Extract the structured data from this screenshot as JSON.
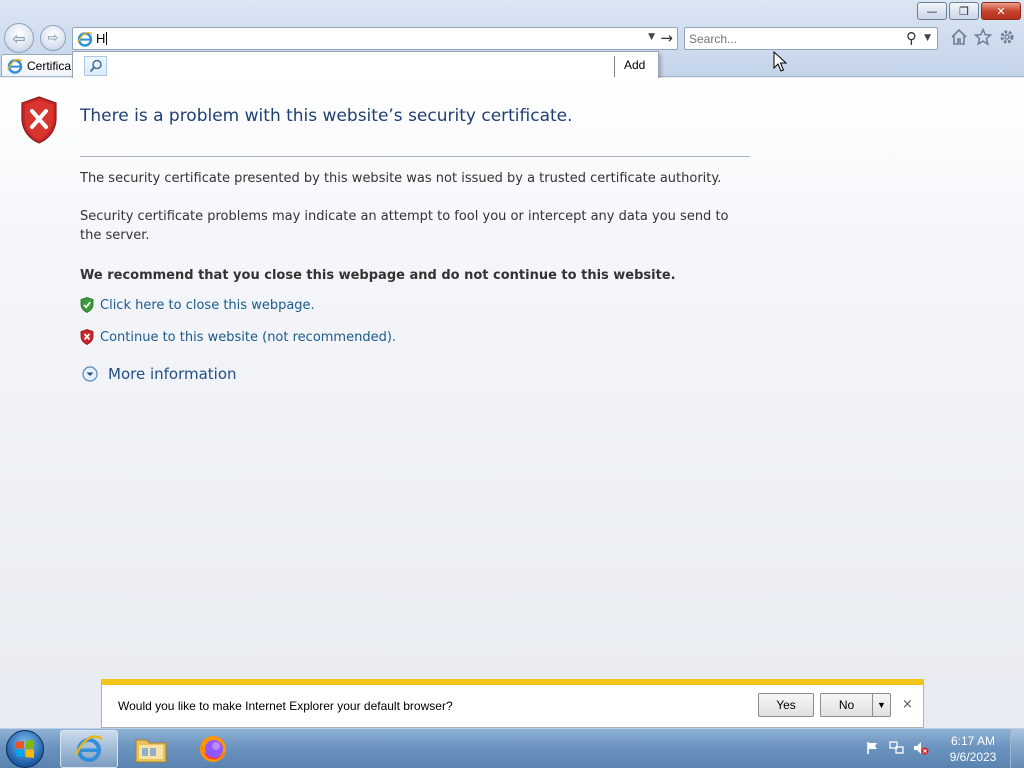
{
  "window": {
    "minimize_glyph": "—",
    "maximize_glyph": "❐",
    "close_glyph": "✕"
  },
  "toolbar": {
    "back_glyph": "⇦",
    "forward_glyph": "⇨",
    "address_value": "H",
    "address_dropdown_glyph": "▼",
    "go_glyph": "→",
    "search_placeholder": "Search...",
    "search_glyph": "⚲",
    "search_dropdown_glyph": "▼",
    "icons": [
      "home-icon",
      "favorites-icon",
      "tools-icon"
    ]
  },
  "tab": {
    "title": "Certifica"
  },
  "suggest": {
    "add_label": "Add"
  },
  "page": {
    "title": "There is a problem with this website’s security certificate.",
    "p1": "The security certificate presented by this website was not issued by a trusted certificate authority.",
    "p2": "Security certificate problems may indicate an attempt to fool you or intercept any data you send to the server.",
    "p3": "We recommend that you close this webpage and do not continue to this website.",
    "close_link": "Click here to close this webpage.",
    "continue_link": "Continue to this website (not recommended).",
    "more_info": "More information"
  },
  "notification": {
    "message": "Would you like to make Internet Explorer your default browser?",
    "yes_label": "Yes",
    "no_label": "No",
    "dropdown_glyph": "▼",
    "close_glyph": "×"
  },
  "taskbar": {
    "time": "6:17 AM",
    "date": "9/6/2023",
    "pinned": [
      "internet-explorer",
      "windows-explorer",
      "firefox"
    ]
  },
  "colors": {
    "title_blue": "#1f3f73",
    "link_blue": "#1b5a8a",
    "shield_red": "#c8262a",
    "shield_green": "#3c9a3c",
    "notify_accent": "#f2c318"
  }
}
